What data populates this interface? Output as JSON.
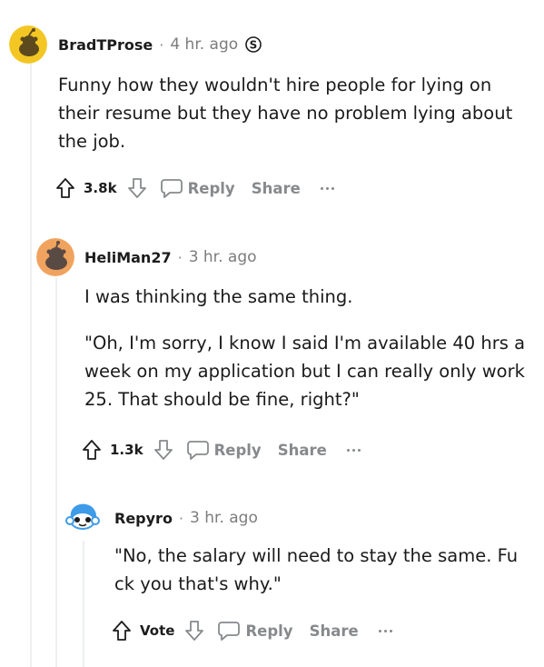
{
  "comments": [
    {
      "author": "BradTProse",
      "separator": "·",
      "time": "4 hr. ago",
      "body": [
        "Funny how they wouldn't hire people for lying on their resume but they have no problem lying about the job."
      ],
      "score": "3.8k",
      "reply_label": "Reply",
      "share_label": "Share",
      "avatar_color": "#f3c623",
      "badge_icon": "premium-s-badge-icon"
    },
    {
      "author": "HeliMan27",
      "separator": "·",
      "time": "3 hr. ago",
      "body": [
        "I was thinking the same thing.",
        "\"Oh, I'm sorry, I know I said I'm available 40 hrs a week on my application but I can really only work 25. That should be fine, right?\""
      ],
      "score": "1.3k",
      "reply_label": "Reply",
      "share_label": "Share",
      "avatar_color": "#f0a35e"
    },
    {
      "author": "Repyro",
      "separator": "·",
      "time": "3 hr. ago",
      "body": [
        "\"No, the salary will need to stay the same. Fu ck you that's why.\""
      ],
      "score": "Vote",
      "reply_label": "Reply",
      "share_label": "Share",
      "avatar_color": "#3d9be9"
    }
  ]
}
